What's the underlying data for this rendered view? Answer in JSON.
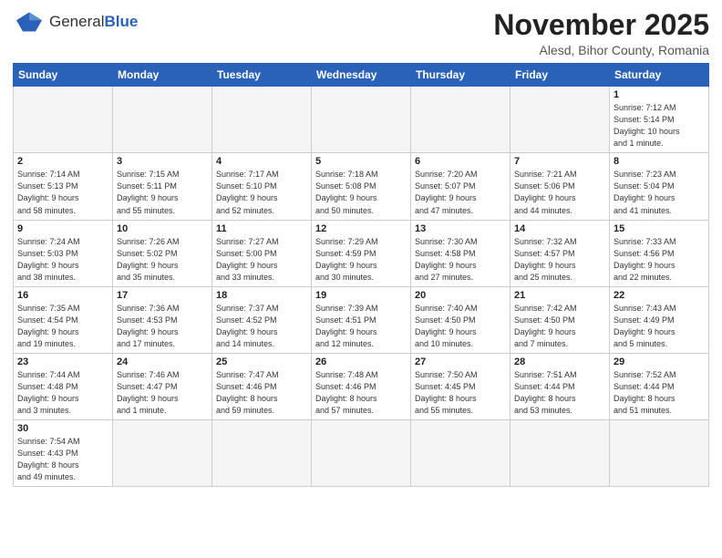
{
  "header": {
    "logo_general": "General",
    "logo_blue": "Blue",
    "title": "November 2025",
    "subtitle": "Alesd, Bihor County, Romania"
  },
  "weekdays": [
    "Sunday",
    "Monday",
    "Tuesday",
    "Wednesday",
    "Thursday",
    "Friday",
    "Saturday"
  ],
  "weeks": [
    [
      {
        "day": "",
        "info": "",
        "empty": true
      },
      {
        "day": "",
        "info": "",
        "empty": true
      },
      {
        "day": "",
        "info": "",
        "empty": true
      },
      {
        "day": "",
        "info": "",
        "empty": true
      },
      {
        "day": "",
        "info": "",
        "empty": true
      },
      {
        "day": "",
        "info": "",
        "empty": true
      },
      {
        "day": "1",
        "info": "Sunrise: 7:12 AM\nSunset: 5:14 PM\nDaylight: 10 hours\nand 1 minute."
      }
    ],
    [
      {
        "day": "2",
        "info": "Sunrise: 7:14 AM\nSunset: 5:13 PM\nDaylight: 9 hours\nand 58 minutes."
      },
      {
        "day": "3",
        "info": "Sunrise: 7:15 AM\nSunset: 5:11 PM\nDaylight: 9 hours\nand 55 minutes."
      },
      {
        "day": "4",
        "info": "Sunrise: 7:17 AM\nSunset: 5:10 PM\nDaylight: 9 hours\nand 52 minutes."
      },
      {
        "day": "5",
        "info": "Sunrise: 7:18 AM\nSunset: 5:08 PM\nDaylight: 9 hours\nand 50 minutes."
      },
      {
        "day": "6",
        "info": "Sunrise: 7:20 AM\nSunset: 5:07 PM\nDaylight: 9 hours\nand 47 minutes."
      },
      {
        "day": "7",
        "info": "Sunrise: 7:21 AM\nSunset: 5:06 PM\nDaylight: 9 hours\nand 44 minutes."
      },
      {
        "day": "8",
        "info": "Sunrise: 7:23 AM\nSunset: 5:04 PM\nDaylight: 9 hours\nand 41 minutes."
      }
    ],
    [
      {
        "day": "9",
        "info": "Sunrise: 7:24 AM\nSunset: 5:03 PM\nDaylight: 9 hours\nand 38 minutes."
      },
      {
        "day": "10",
        "info": "Sunrise: 7:26 AM\nSunset: 5:02 PM\nDaylight: 9 hours\nand 35 minutes."
      },
      {
        "day": "11",
        "info": "Sunrise: 7:27 AM\nSunset: 5:00 PM\nDaylight: 9 hours\nand 33 minutes."
      },
      {
        "day": "12",
        "info": "Sunrise: 7:29 AM\nSunset: 4:59 PM\nDaylight: 9 hours\nand 30 minutes."
      },
      {
        "day": "13",
        "info": "Sunrise: 7:30 AM\nSunset: 4:58 PM\nDaylight: 9 hours\nand 27 minutes."
      },
      {
        "day": "14",
        "info": "Sunrise: 7:32 AM\nSunset: 4:57 PM\nDaylight: 9 hours\nand 25 minutes."
      },
      {
        "day": "15",
        "info": "Sunrise: 7:33 AM\nSunset: 4:56 PM\nDaylight: 9 hours\nand 22 minutes."
      }
    ],
    [
      {
        "day": "16",
        "info": "Sunrise: 7:35 AM\nSunset: 4:54 PM\nDaylight: 9 hours\nand 19 minutes."
      },
      {
        "day": "17",
        "info": "Sunrise: 7:36 AM\nSunset: 4:53 PM\nDaylight: 9 hours\nand 17 minutes."
      },
      {
        "day": "18",
        "info": "Sunrise: 7:37 AM\nSunset: 4:52 PM\nDaylight: 9 hours\nand 14 minutes."
      },
      {
        "day": "19",
        "info": "Sunrise: 7:39 AM\nSunset: 4:51 PM\nDaylight: 9 hours\nand 12 minutes."
      },
      {
        "day": "20",
        "info": "Sunrise: 7:40 AM\nSunset: 4:50 PM\nDaylight: 9 hours\nand 10 minutes."
      },
      {
        "day": "21",
        "info": "Sunrise: 7:42 AM\nSunset: 4:50 PM\nDaylight: 9 hours\nand 7 minutes."
      },
      {
        "day": "22",
        "info": "Sunrise: 7:43 AM\nSunset: 4:49 PM\nDaylight: 9 hours\nand 5 minutes."
      }
    ],
    [
      {
        "day": "23",
        "info": "Sunrise: 7:44 AM\nSunset: 4:48 PM\nDaylight: 9 hours\nand 3 minutes."
      },
      {
        "day": "24",
        "info": "Sunrise: 7:46 AM\nSunset: 4:47 PM\nDaylight: 9 hours\nand 1 minute."
      },
      {
        "day": "25",
        "info": "Sunrise: 7:47 AM\nSunset: 4:46 PM\nDaylight: 8 hours\nand 59 minutes."
      },
      {
        "day": "26",
        "info": "Sunrise: 7:48 AM\nSunset: 4:46 PM\nDaylight: 8 hours\nand 57 minutes."
      },
      {
        "day": "27",
        "info": "Sunrise: 7:50 AM\nSunset: 4:45 PM\nDaylight: 8 hours\nand 55 minutes."
      },
      {
        "day": "28",
        "info": "Sunrise: 7:51 AM\nSunset: 4:44 PM\nDaylight: 8 hours\nand 53 minutes."
      },
      {
        "day": "29",
        "info": "Sunrise: 7:52 AM\nSunset: 4:44 PM\nDaylight: 8 hours\nand 51 minutes."
      }
    ],
    [
      {
        "day": "30",
        "info": "Sunrise: 7:54 AM\nSunset: 4:43 PM\nDaylight: 8 hours\nand 49 minutes.",
        "last": true
      },
      {
        "day": "",
        "info": "",
        "empty": true,
        "last": true
      },
      {
        "day": "",
        "info": "",
        "empty": true,
        "last": true
      },
      {
        "day": "",
        "info": "",
        "empty": true,
        "last": true
      },
      {
        "day": "",
        "info": "",
        "empty": true,
        "last": true
      },
      {
        "day": "",
        "info": "",
        "empty": true,
        "last": true
      },
      {
        "day": "",
        "info": "",
        "empty": true,
        "last": true
      }
    ]
  ]
}
